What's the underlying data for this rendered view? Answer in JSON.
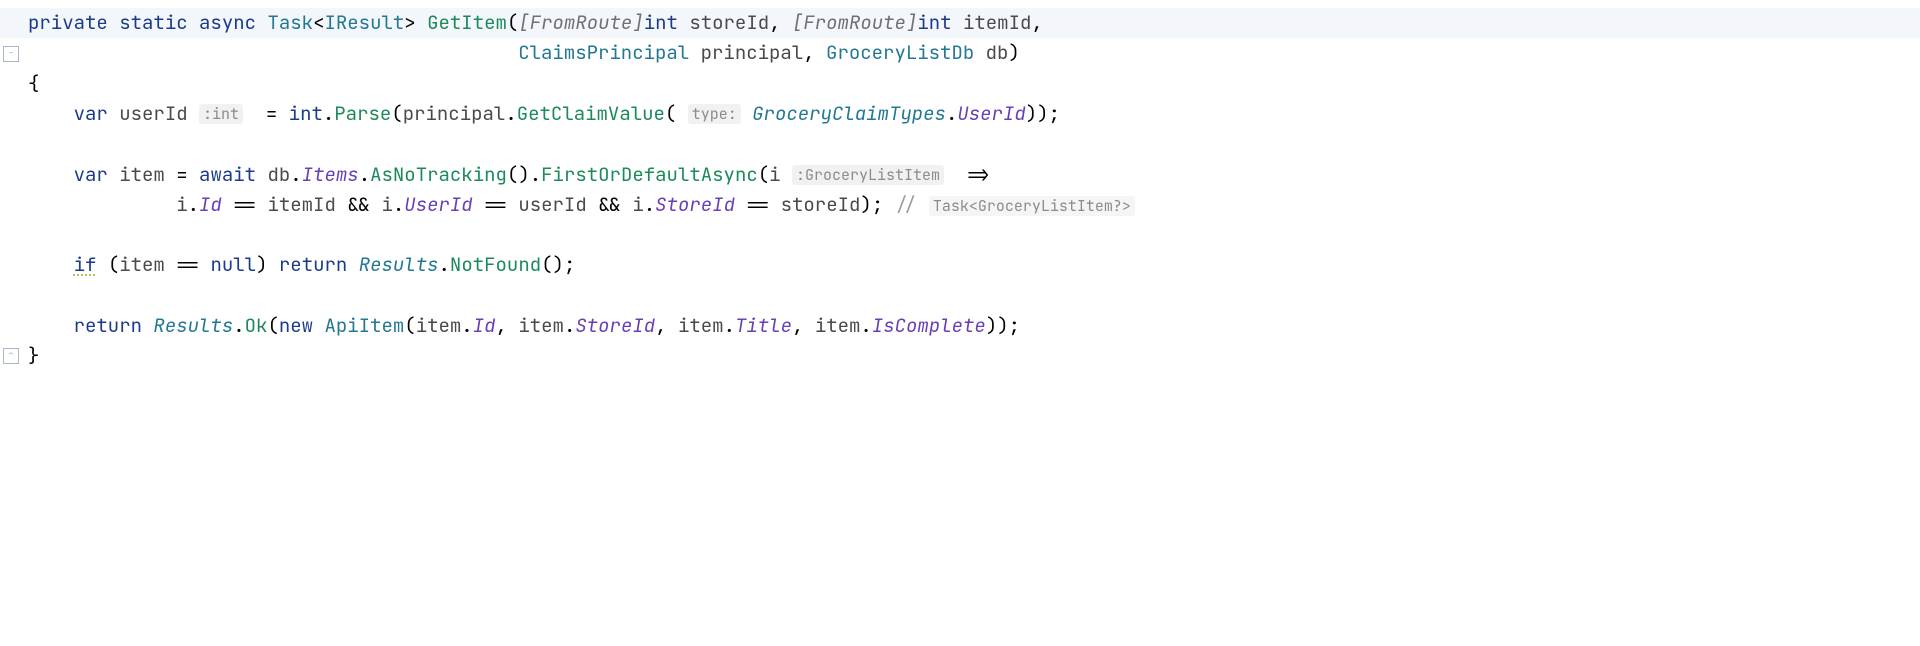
{
  "code": {
    "line1": {
      "kw_private": "private",
      "kw_static": "static",
      "kw_async": "async",
      "type_task": "Task",
      "lt": "<",
      "type_iresult": "IResult",
      "gt": ">",
      "method_getitem": "GetItem",
      "lparen": "(",
      "attr_fromroute1": "[FromRoute]",
      "type_int1": "int",
      "param_storeid": "storeId",
      "comma1": ",",
      "attr_fromroute2": "[FromRoute]",
      "type_int2": "int",
      "param_itemid": "itemId",
      "comma2": ","
    },
    "line2": {
      "type_claimsprincipal": "ClaimsPrincipal",
      "param_principal": "principal",
      "comma": ",",
      "type_grocerylistdb": "GroceryListDb",
      "param_db": "db",
      "rparen": ")"
    },
    "line3": {
      "brace": "{"
    },
    "line4": {
      "kw_var": "var",
      "var_userid": "userId",
      "hint_int": ":int",
      "eq": "=",
      "type_int": "int",
      "dot1": ".",
      "method_parse": "Parse",
      "lparen": "(",
      "var_principal": "principal",
      "dot2": ".",
      "method_getclaimvalue": "GetClaimValue",
      "lparen2": "(",
      "hint_type": "type:",
      "static_groceryclaimtypes": "GroceryClaimTypes",
      "dot3": ".",
      "prop_userid": "UserId",
      "rparen": "))",
      "semi": ";"
    },
    "line5": {
      "kw_var": "var",
      "var_item": "item",
      "eq": "=",
      "kw_await": "await",
      "var_db": "db",
      "dot1": ".",
      "prop_items": "Items",
      "dot2": ".",
      "method_asnotracking": "AsNoTracking",
      "parens1": "()",
      "dot3": ".",
      "method_firstordefault": "FirstOrDefaultAsync",
      "lparen": "(",
      "var_i": "i",
      "hint_grocerylistitem": ":GroceryListItem",
      "arrow": "=>"
    },
    "line6": {
      "var_i1": "i",
      "dot1": ".",
      "prop_id": "Id",
      "eqeq1": "==",
      "var_itemid": "itemId",
      "and1": "&&",
      "var_i2": "i",
      "dot2": ".",
      "prop_userid": "UserId",
      "eqeq2": "==",
      "var_userid": "userId",
      "and2": "&&",
      "var_i3": "i",
      "dot3": ".",
      "prop_storeid": "StoreId",
      "eqeq3": "==",
      "var_storeid": "storeId",
      "rparen": ")",
      "semi": ";",
      "comment_slashes": "//",
      "comment_hint": "Task<GroceryListItem?>"
    },
    "line7": {
      "kw_if": "if",
      "lparen": "(",
      "var_item": "item",
      "eqeq": "==",
      "kw_null": "null",
      "rparen": ")",
      "kw_return": "return",
      "static_results": "Results",
      "dot": ".",
      "method_notfound": "NotFound",
      "parens": "()",
      "semi": ";"
    },
    "line8": {
      "kw_return": "return",
      "static_results": "Results",
      "dot1": ".",
      "method_ok": "Ok",
      "lparen": "(",
      "kw_new": "new",
      "type_apiitem": "ApiItem",
      "lparen2": "(",
      "var_item1": "item",
      "dot2": ".",
      "prop_id": "Id",
      "comma1": ",",
      "var_item2": "item",
      "dot3": ".",
      "prop_storeid": "StoreId",
      "comma2": ",",
      "var_item3": "item",
      "dot4": ".",
      "prop_title": "Title",
      "comma3": ",",
      "var_item4": "item",
      "dot5": ".",
      "prop_iscomplete": "IsComplete",
      "rparens": "))",
      "semi": ";"
    },
    "line9": {
      "brace": "}"
    }
  }
}
